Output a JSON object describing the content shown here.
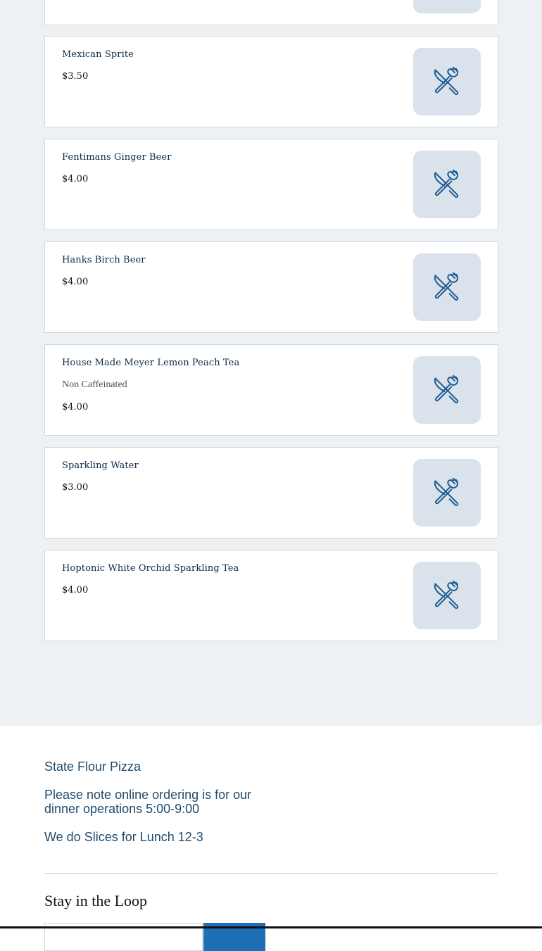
{
  "menu": {
    "items": [
      {
        "name": "",
        "description": "",
        "price": "",
        "image_icon": "utensils-icon"
      },
      {
        "name": "Mexican Sprite",
        "description": "",
        "price": "$3.50",
        "image_icon": "utensils-icon"
      },
      {
        "name": "Fentimans Ginger Beer",
        "description": "",
        "price": "$4.00",
        "image_icon": "utensils-icon"
      },
      {
        "name": "Hanks Birch Beer",
        "description": "",
        "price": "$4.00",
        "image_icon": "utensils-icon"
      },
      {
        "name": "House Made Meyer Lemon Peach Tea",
        "description": "Non Caffeinated",
        "price": "$4.00",
        "image_icon": "utensils-icon"
      },
      {
        "name": "Sparkling Water",
        "description": "",
        "price": "$3.00",
        "image_icon": "utensils-icon"
      },
      {
        "name": "Hoptonic White Orchid Sparkling Tea",
        "description": "",
        "price": "$4.00",
        "image_icon": "utensils-icon"
      }
    ]
  },
  "footer": {
    "restaurant_name": "State Flour Pizza",
    "note_line1": "Please note online ordering is for our",
    "note_line2": "dinner operations 5:00-9:00",
    "lunch_note": "We do Slices for Lunch 12-3",
    "newsletter_title": "Stay in the Loop",
    "email_placeholder": "",
    "subscribe_label": ""
  },
  "colors": {
    "page_bg": "#eef1f4",
    "card_border": "#cfd6dd",
    "thumb_bg": "#dae3eb",
    "icon_stroke": "#1e5d94",
    "item_name": "#0e2a46",
    "footer_text": "#1f4a6e",
    "button": "#1e6fb5"
  }
}
